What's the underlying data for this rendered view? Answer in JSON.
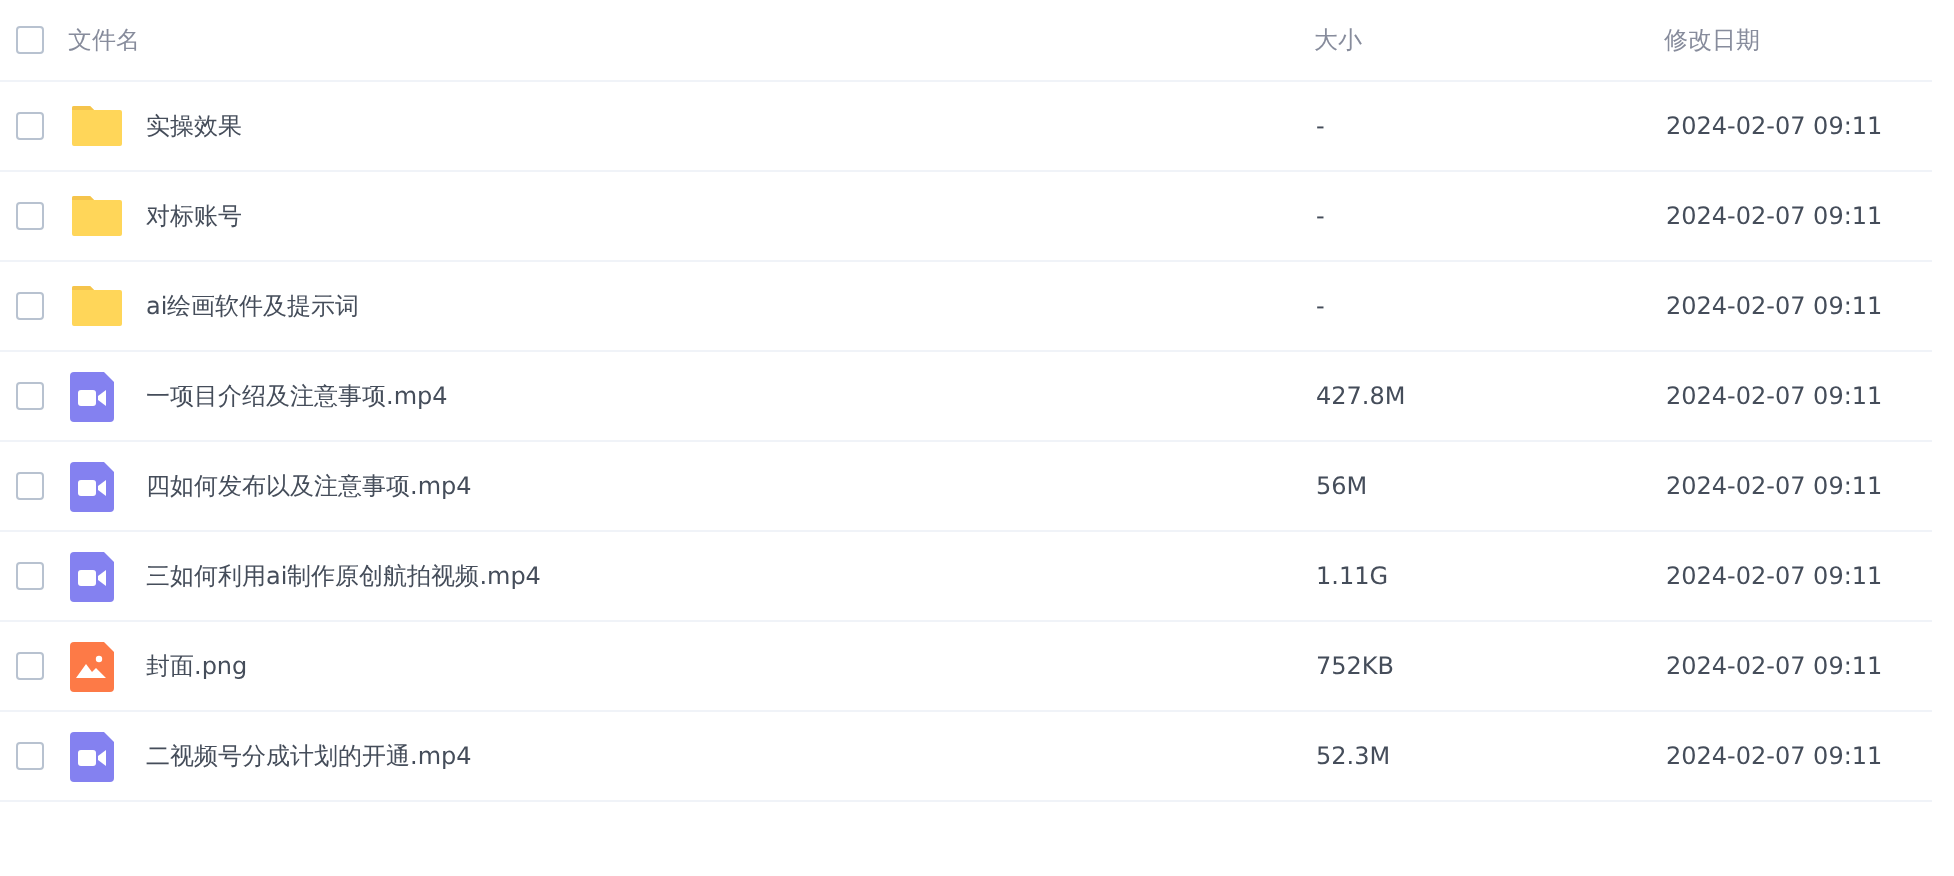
{
  "table": {
    "select_all": {
      "checked": false
    },
    "columns": [
      "文件名",
      "大小",
      "修改日期"
    ],
    "rows": [
      {
        "kind": "folder",
        "name": "实操效果",
        "size": "-",
        "modified": "2024-02-07 09:11",
        "checked": false
      },
      {
        "kind": "folder",
        "name": "对标账号",
        "size": "-",
        "modified": "2024-02-07 09:11",
        "checked": false
      },
      {
        "kind": "folder",
        "name": "ai绘画软件及提示词",
        "size": "-",
        "modified": "2024-02-07 09:11",
        "checked": false
      },
      {
        "kind": "video",
        "name": "一项目介绍及注意事项.mp4",
        "size": "427.8M",
        "modified": "2024-02-07 09:11",
        "checked": false
      },
      {
        "kind": "video",
        "name": "四如何发布以及注意事项.mp4",
        "size": "56M",
        "modified": "2024-02-07 09:11",
        "checked": false
      },
      {
        "kind": "video",
        "name": "三如何利用ai制作原创航拍视频.mp4",
        "size": "1.11G",
        "modified": "2024-02-07 09:11",
        "checked": false
      },
      {
        "kind": "image",
        "name": "封面.png",
        "size": "752KB",
        "modified": "2024-02-07 09:11",
        "checked": false
      },
      {
        "kind": "video",
        "name": "二视频号分成计划的开通.mp4",
        "size": "52.3M",
        "modified": "2024-02-07 09:11",
        "checked": false
      }
    ]
  }
}
